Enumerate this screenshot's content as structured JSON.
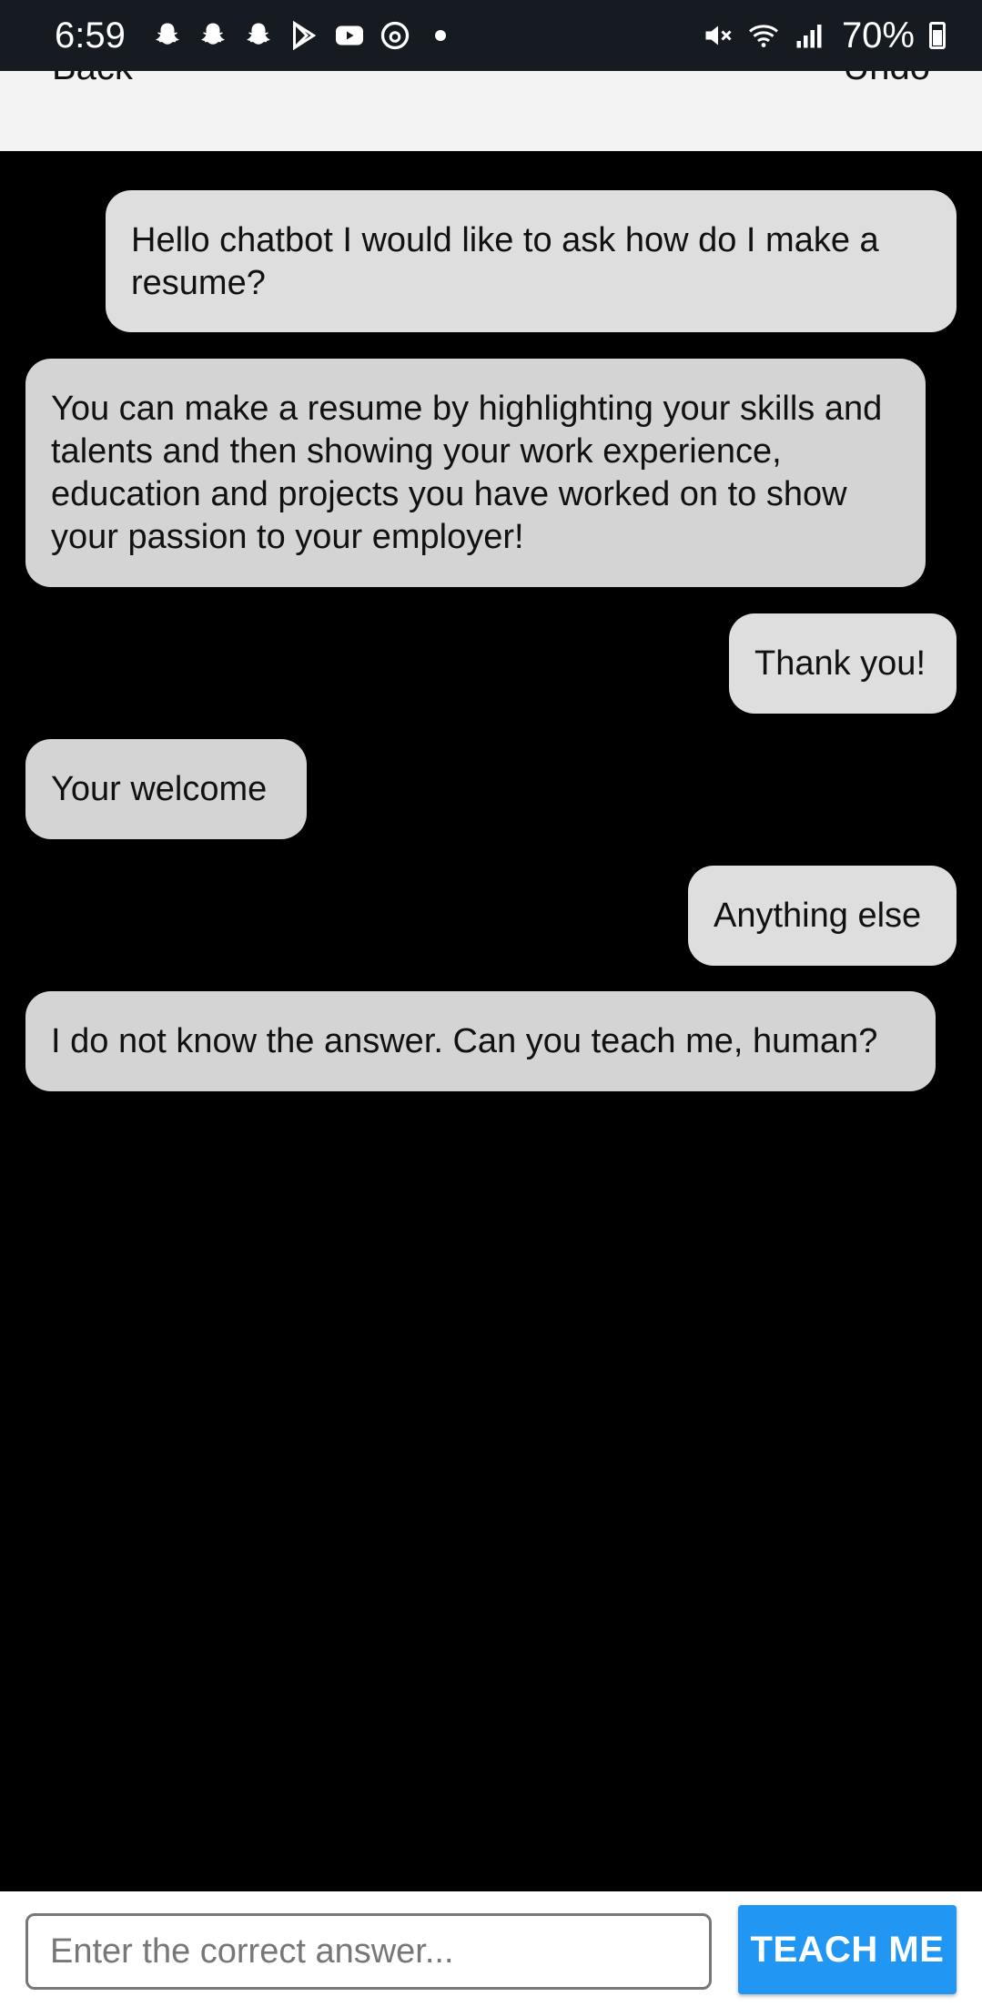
{
  "status_bar": {
    "time": "6:59",
    "battery_percent": "70%",
    "notification_icons": [
      "snapchat-icon",
      "snapchat-icon",
      "snapchat-icon",
      "play-store-icon",
      "youtube-icon",
      "threads-icon"
    ],
    "system_icons": [
      "mute-icon",
      "wifi-icon",
      "signal-icon",
      "battery-icon"
    ]
  },
  "nav": {
    "back_label": "Back",
    "undo_label": "Undo"
  },
  "messages": [
    {
      "sender": "user",
      "text": "Hello chatbot I would like to ask how do I make a resume?"
    },
    {
      "sender": "bot",
      "text": "You can make a resume by highlighting your skills and talents and then showing your work experience, education and projects you have worked on to show your passion to your employer!"
    },
    {
      "sender": "user",
      "text": "Thank you!"
    },
    {
      "sender": "bot",
      "text": "Your welcome"
    },
    {
      "sender": "user",
      "text": "Anything else"
    },
    {
      "sender": "bot",
      "text": "I do not know the answer. Can you teach me, human?"
    }
  ],
  "input": {
    "placeholder": "Enter the correct answer...",
    "value": ""
  },
  "teach_button_label": "TEACH ME",
  "colors": {
    "status_bar_bg": "#161b22",
    "chat_bg": "#000000",
    "user_bubble": "#dedede",
    "bot_bubble": "#d4d4d4",
    "accent": "#2196f3"
  }
}
